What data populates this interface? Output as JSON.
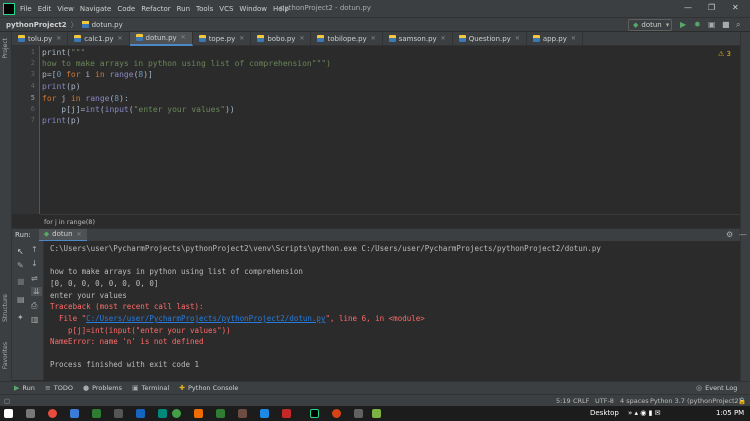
{
  "menubar": {
    "items": [
      "File",
      "Edit",
      "View",
      "Navigate",
      "Code",
      "Refactor",
      "Run",
      "Tools",
      "VCS",
      "Window",
      "Help"
    ],
    "title": "pythonProject2 - dotun.py",
    "minimize": "—",
    "maximize": "❐",
    "close": "✕"
  },
  "navbar": {
    "project": "pythonProject2",
    "file": "dotun.py",
    "run_config": "dotun"
  },
  "tabs": [
    {
      "label": "tolu.py"
    },
    {
      "label": "calc1.py"
    },
    {
      "label": "dotun.py",
      "active": true
    },
    {
      "label": "tope.py"
    },
    {
      "label": "bobo.py"
    },
    {
      "label": "tobilope.py"
    },
    {
      "label": "samson.py"
    },
    {
      "label": "Question.py"
    },
    {
      "label": "app.py"
    }
  ],
  "editor": {
    "line_numbers": [
      "1",
      "2",
      "3",
      "4",
      "5",
      "6",
      "7"
    ],
    "warnings": "⚠ 3",
    "breadcrumb": "for j in range(8)"
  },
  "code": {
    "l1a": "print(",
    "l1b": "\"\"\"",
    "l2": "how to make arrays in python using list of comprehension\"\"\")",
    "l3a": "p=[",
    "l3b": "0",
    "l3c": " ",
    "l3d": "for",
    "l3e": " i ",
    "l3f": "in",
    "l3g": " ",
    "l3h": "range",
    "l3i": "(",
    "l3j": "8",
    "l3k": ")]",
    "l4a": "print",
    "l4b": "(p)",
    "l5a": "for",
    "l5b": " j ",
    "l5c": "in",
    "l5d": " ",
    "l5e": "range",
    "l5f": "(",
    "l5g": "8",
    "l5h": "):",
    "l6a": "    p[j]=",
    "l6b": "int",
    "l6c": "(",
    "l6d": "input",
    "l6e": "(",
    "l6f": "\"enter your values\"",
    "l6g": "))",
    "l7a": "print",
    "l7b": "(p)"
  },
  "run": {
    "label": "Run:",
    "config": "dotun",
    "console": {
      "cmd": "C:\\Users\\user\\PycharmProjects\\pythonProject2\\venv\\Scripts\\python.exe C:/Users/user/PycharmProjects/pythonProject2/dotun.py",
      "out1": "how to make arrays in python using list of comprehension",
      "out2": "[0, 0, 0, 0, 0, 0, 0, 0]",
      "out3": "enter your values",
      "tb": "Traceback (most recent call last):",
      "file_pre": "  File \"",
      "file_link": "C:/Users/user/PycharmProjects/pythonProject2/dotun.py",
      "file_post": "\", line 6, in <module>",
      "code_line": "    p[j]=int(input(\"enter your values\"))",
      "name_error": "NameError: name 'n' is not defined",
      "exit": "Process finished with exit code 1"
    }
  },
  "left_labels": {
    "project": "Project",
    "structure": "Structure",
    "favorites": "Favorites"
  },
  "bottom_tabs": [
    {
      "label": "Run",
      "icon": "▶"
    },
    {
      "label": "TODO",
      "icon": "≡"
    },
    {
      "label": "Problems",
      "icon": "●"
    },
    {
      "label": "Terminal",
      "icon": "▣"
    },
    {
      "label": "Python Console",
      "icon": "✚"
    }
  ],
  "event_log": "Event Log",
  "status": {
    "position": "5:19",
    "line_sep": "CRLF",
    "encoding": "UTF-8",
    "indent": "4 spaces",
    "interpreter": "Python 3.7 (pythonProject2)"
  },
  "taskbar": {
    "desktop": "Desktop",
    "time": "1:05 PM"
  }
}
